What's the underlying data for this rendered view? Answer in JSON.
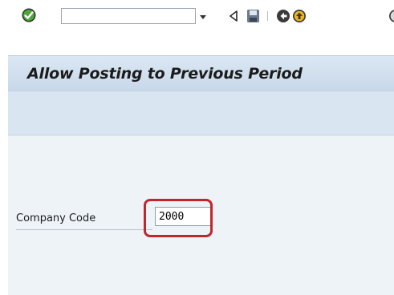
{
  "toolbar": {
    "enter_icon": "green-check-icon",
    "command_field_value": "",
    "dropdown_icon": "chevron-down-icon",
    "back_icon": "triangle-left-icon",
    "save_icon": "floppy-disk-icon",
    "navigate_back_icon": "back-arrow-icon",
    "exit_icon": "exit-icon",
    "cancel_icon": "cancel-icon"
  },
  "title": "Allow Posting to Previous Period",
  "form": {
    "company_code_label": "Company Code",
    "company_code_value": "2000"
  },
  "colors": {
    "title_band": "#c8d8ea",
    "content_bg": "#eef3f8",
    "highlight": "#c0272d",
    "enter_icon_green": "#2e8b2e"
  }
}
